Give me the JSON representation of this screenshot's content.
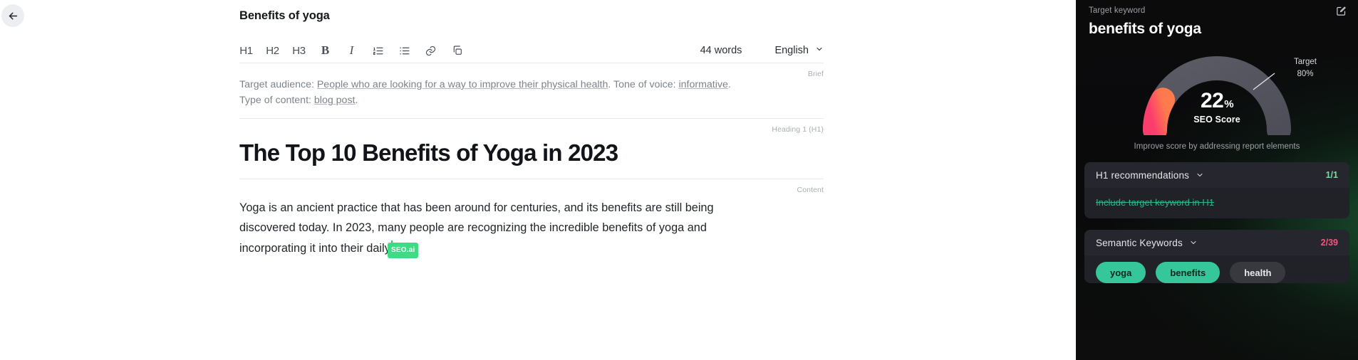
{
  "editor": {
    "back_icon": "arrow-left-icon",
    "doc_title": "Benefits of yoga",
    "toolbar": {
      "h1": "H1",
      "h2": "H2",
      "h3": "H3",
      "bold": "B",
      "italic": "I",
      "ordered_list_icon": "numbered-list-icon",
      "bullet_list_icon": "bullet-list-icon",
      "link_icon": "link-icon",
      "copy_icon": "copy-icon",
      "word_count": "44 words",
      "language": "English",
      "language_chevron": "chevron-down-icon"
    },
    "brief": {
      "label": "Brief",
      "prefix_audience": "Target audience: ",
      "audience": "People who are looking for a way to improve their physical health",
      "mid_tone": ". Tone of voice: ",
      "tone": "informative",
      "mid_type": ". Type of content: ",
      "content_type": "blog post",
      "suffix": "."
    },
    "heading": {
      "label": "Heading 1 (H1)",
      "text": "The Top 10 Benefits of Yoga in 2023"
    },
    "content": {
      "label": "Content",
      "text": "Yoga is an ancient practice that has been around for centuries, and its benefits are still being discovered today. In 2023, many people are recognizing the incredible benefits of yoga and incorporating it into their daily",
      "cursor_label": "SEO.ai",
      "cursor_color": "#3ddb84"
    }
  },
  "seo_panel": {
    "keyword_label": "Target keyword",
    "keyword_value": "benefits of yoga",
    "edit_icon": "edit-square-icon",
    "gauge": {
      "score": "22",
      "percent_symbol": "%",
      "score_caption": "SEO Score",
      "target_label": "Target",
      "target_value": "80%",
      "note": "Improve score by addressing report elements",
      "score_number": 22,
      "target_number": 80,
      "arc_color_start": "#ff4d7e",
      "arc_color_end": "#ff7a4d",
      "track_color": "#55555f"
    },
    "sections": [
      {
        "title": "H1 recommendations",
        "chevron": "chevron-down-icon",
        "count": "1/1",
        "count_color": "#7fd6a8",
        "recommendation": "Include target keyword in H1"
      },
      {
        "title": "Semantic Keywords",
        "chevron": "chevron-down-icon",
        "count": "2/39",
        "count_color": "#f4567f",
        "chips": [
          {
            "label": "yoga",
            "used": true
          },
          {
            "label": "benefits",
            "used": true
          },
          {
            "label": "health",
            "used": false
          }
        ]
      }
    ]
  }
}
